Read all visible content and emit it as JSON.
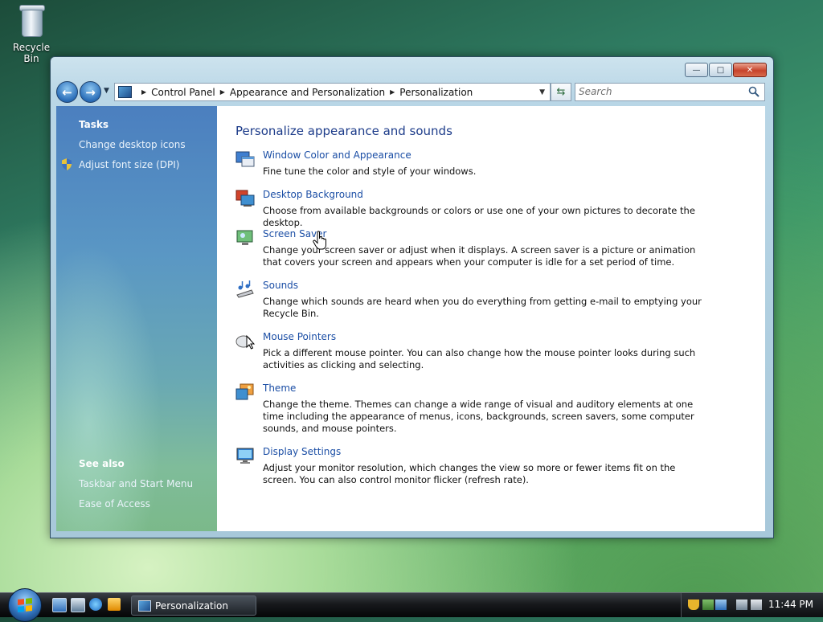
{
  "desktop": {
    "recycle_bin_label": "Recycle Bin"
  },
  "window": {
    "caption_buttons": {
      "minimize": "—",
      "maximize": "□",
      "close": "✕"
    },
    "address": {
      "crumbs": [
        "Control Panel",
        "Appearance and Personalization",
        "Personalization"
      ]
    },
    "search": {
      "placeholder": "Search"
    },
    "tasks": {
      "heading": "Tasks",
      "links": [
        "Change desktop icons",
        "Adjust font size (DPI)"
      ]
    },
    "see_also": {
      "heading": "See also",
      "links": [
        "Taskbar and Start Menu",
        "Ease of Access"
      ]
    },
    "main": {
      "heading": "Personalize appearance and sounds",
      "items": [
        {
          "title": "Window Color and Appearance",
          "desc": "Fine tune the color and style of your windows.",
          "icon": "window-color-icon"
        },
        {
          "title": "Desktop Background",
          "desc": "Choose from available backgrounds or colors or use one of your own pictures to decorate the desktop.",
          "icon": "desktop-background-icon"
        },
        {
          "title": "Screen Saver",
          "desc": "Change your screen saver or adjust when it displays. A screen saver is a picture or animation that covers your screen and appears when your computer is idle for a set period of time.",
          "icon": "screen-saver-icon"
        },
        {
          "title": "Sounds",
          "desc": "Change which sounds are heard when you do everything from getting e-mail to emptying your Recycle Bin.",
          "icon": "sounds-icon"
        },
        {
          "title": "Mouse Pointers",
          "desc": "Pick a different mouse pointer. You can also change how the mouse pointer looks during such activities as clicking and selecting.",
          "icon": "mouse-pointers-icon"
        },
        {
          "title": "Theme",
          "desc": "Change the theme. Themes can change a wide range of visual and auditory elements at one time including the appearance of menus, icons, backgrounds, screen savers, some computer sounds, and mouse pointers.",
          "icon": "theme-icon"
        },
        {
          "title": "Display Settings",
          "desc": "Adjust your monitor resolution, which changes the view so more or fewer items fit on the screen. You can also control monitor flicker (refresh rate).",
          "icon": "display-settings-icon"
        }
      ]
    }
  },
  "taskbar": {
    "active_task": "Personalization",
    "clock": "11:44 PM"
  },
  "colors": {
    "link": "#1b4ea5",
    "heading": "#1d3c8a"
  }
}
